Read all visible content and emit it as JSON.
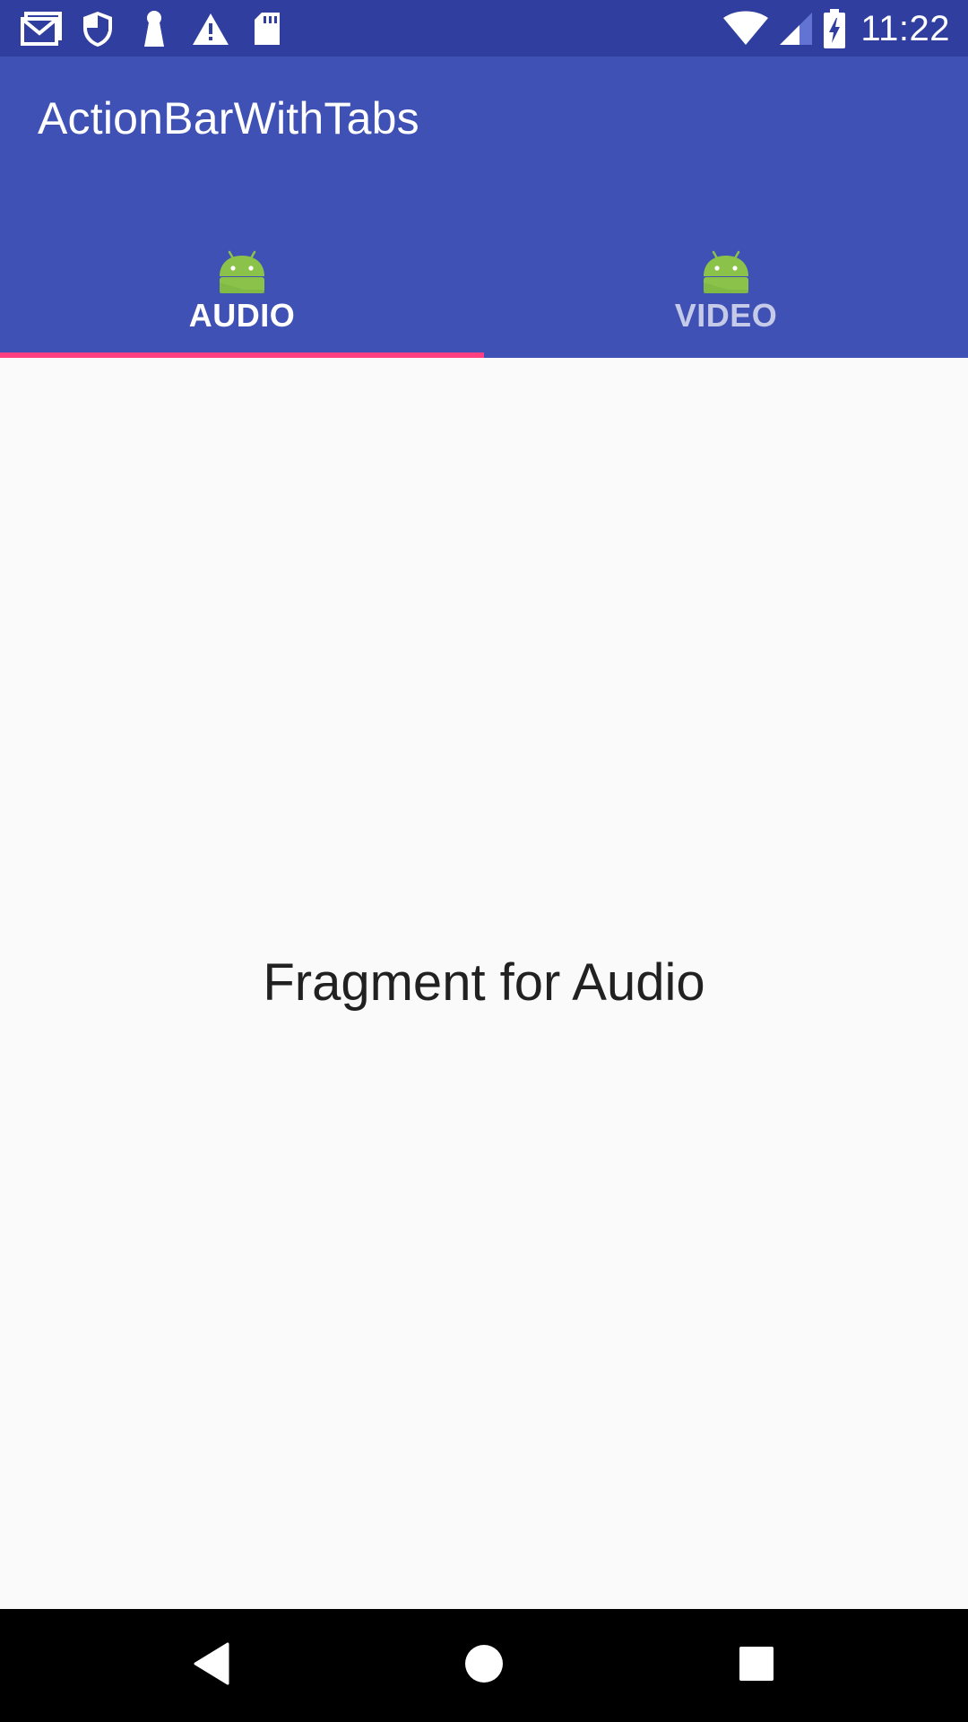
{
  "status_bar": {
    "left_icons": [
      "gmail-icon",
      "shield-icon",
      "keyhole-icon",
      "warning-icon",
      "sd-card-icon"
    ],
    "right_icons": [
      "wifi-icon",
      "cell-signal-icon",
      "battery-charging-icon"
    ],
    "time": "11:22"
  },
  "app_bar": {
    "title": "ActionBarWithTabs",
    "background_color": "#3f51b5",
    "status_bar_color": "#303f9f"
  },
  "tabs": [
    {
      "label": "AUDIO",
      "icon": "android-icon",
      "selected": true
    },
    {
      "label": "VIDEO",
      "icon": "android-icon",
      "selected": false
    }
  ],
  "indicator_color": "#ff4081",
  "content": {
    "text": "Fragment for Audio"
  },
  "nav_bar": {
    "buttons": [
      "back-icon",
      "home-icon",
      "recents-icon"
    ]
  }
}
